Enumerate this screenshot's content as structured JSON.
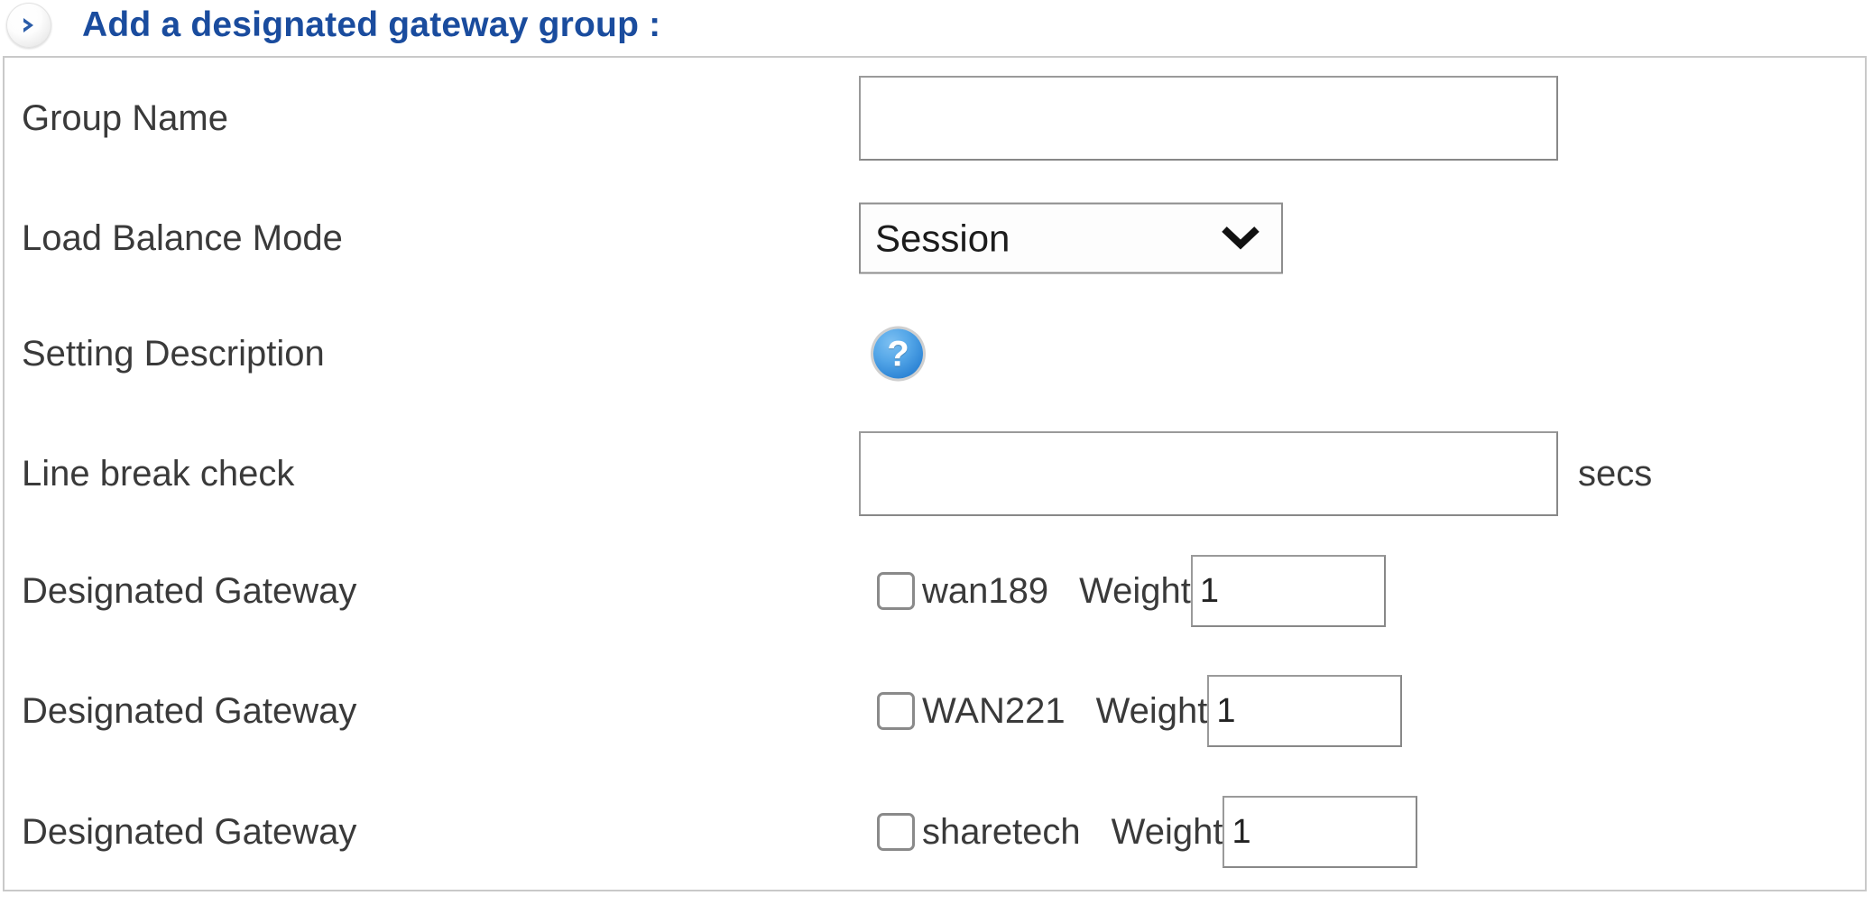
{
  "header": {
    "expand_icon": "chevron-right-circle-icon",
    "title": "Add a designated gateway group :",
    "title_color": "#1a4c9e"
  },
  "form": {
    "group_name": {
      "label": "Group Name",
      "value": "",
      "placeholder": ""
    },
    "load_balance_mode": {
      "label": "Load Balance Mode",
      "selected": "Session",
      "arrow_icon": "chevron-down-icon"
    },
    "setting_description": {
      "label": "Setting Description",
      "help_icon": "question-mark-help-icon",
      "help_glyph": "?"
    },
    "line_break_check": {
      "label": "Line break check",
      "value": "",
      "placeholder": "",
      "suffix": "secs"
    },
    "weight_label": "Weight",
    "gateways": [
      {
        "label": "Designated Gateway",
        "name": "wan189",
        "checked": false,
        "weight": "1"
      },
      {
        "label": "Designated Gateway",
        "name": "WAN221",
        "checked": false,
        "weight": "1"
      },
      {
        "label": "Designated Gateway",
        "name": "sharetech",
        "checked": false,
        "weight": "1"
      }
    ]
  }
}
